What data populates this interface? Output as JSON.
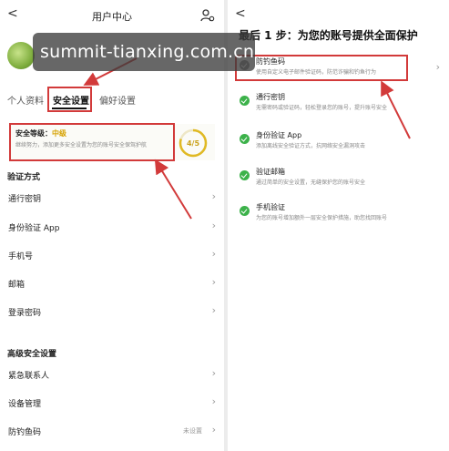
{
  "left": {
    "back_glyph": "<",
    "title": "用户中心",
    "watermark": "summit-tianxing.com.cn",
    "tabs": [
      {
        "label": "个人资料",
        "active": false
      },
      {
        "label": "安全设置",
        "active": true
      },
      {
        "label": "偏好设置",
        "active": false
      }
    ],
    "security_card": {
      "label": "安全等级：",
      "level": "中级",
      "hint": "继续努力，添加更多安全设置为您的账号安全保驾护航",
      "score": "4/5",
      "progress": 0.8
    },
    "verification_section": {
      "title": "验证方式",
      "items": [
        {
          "label": "通行密钥",
          "value": ""
        },
        {
          "label": "身份验证 App",
          "value": ""
        },
        {
          "label": "手机号",
          "value": ""
        },
        {
          "label": "邮箱",
          "value": ""
        },
        {
          "label": "登录密码",
          "value": ""
        }
      ]
    },
    "advanced_section": {
      "title": "高级安全设置",
      "items": [
        {
          "label": "紧急联系人",
          "value": ""
        },
        {
          "label": "设备管理",
          "value": ""
        },
        {
          "label": "防钓鱼码",
          "value": "未设置"
        }
      ]
    }
  },
  "right": {
    "back_glyph": "<",
    "step_title": "最后 1 步：为您的账号提供全面保护",
    "items": [
      {
        "title": "防钓鱼码",
        "desc": "使用自定义电子邮件验证码，防范诈骗和钓鱼行为",
        "done": false,
        "highlighted": true
      },
      {
        "title": "通行密钥",
        "desc": "无需密码或验证码，轻松登录您的账号，提升账号安全",
        "done": true,
        "highlighted": false
      },
      {
        "title": "身份验证 App",
        "desc": "添加离线安全验证方式，抗网络安全漏洞攻击",
        "done": true,
        "highlighted": false
      },
      {
        "title": "验证邮箱",
        "desc": "通过简单的安全设置，无缝保护您的账号安全",
        "done": true,
        "highlighted": false
      },
      {
        "title": "手机验证",
        "desc": "为您的账号增加额外一层安全保护措施，助您找回账号",
        "done": true,
        "highlighted": false
      }
    ]
  },
  "colors": {
    "annotation_red": "#d23a3a",
    "success_green": "#3cb24a",
    "level_yellow": "#d6a200"
  },
  "icons": [
    "back-arrow-icon",
    "user-settings-icon",
    "chevron-right-icon",
    "check-circle-icon",
    "progress-ring"
  ]
}
